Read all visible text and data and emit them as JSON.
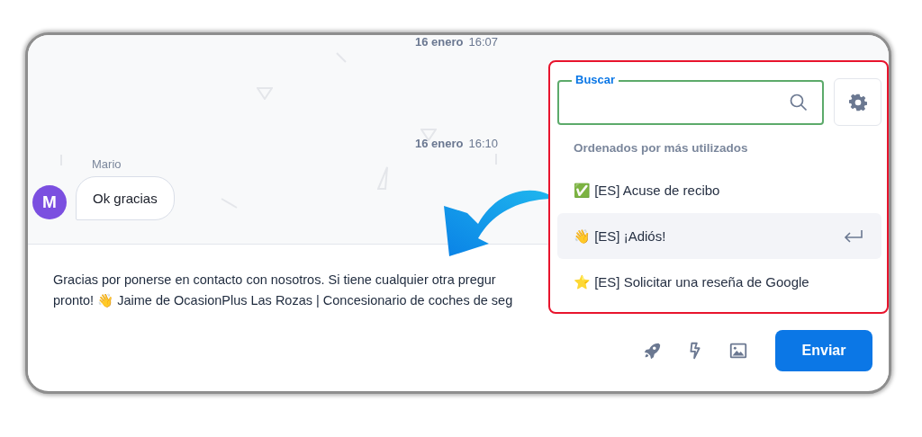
{
  "chat": {
    "timestamps": [
      {
        "date": "16 enero",
        "time": "16:07"
      },
      {
        "date": "16 enero",
        "time": "16:10"
      }
    ],
    "messages": [
      {
        "sender": "Mario",
        "avatar": "M",
        "text": "Ok gracias"
      }
    ]
  },
  "composer": {
    "lines": [
      "Gracias por ponerse en contacto con nosotros. Si tiene cualquier otra pregur",
      "pronto! 👋 Jaime de OcasionPlus Las Rozas | Concesionario de coches de seg"
    ],
    "send_button": "Enviar"
  },
  "templates_popup": {
    "search": {
      "label": "Buscar"
    },
    "heading": "Ordenados por más utilizados",
    "items": [
      {
        "label": "✅ [ES] Acuse de recibo",
        "selected": false
      },
      {
        "label": "👋 [ES] ¡Adiós!",
        "selected": true
      },
      {
        "label": "⭐ [ES] Solicitar una reseña de Google",
        "selected": false
      }
    ]
  }
}
